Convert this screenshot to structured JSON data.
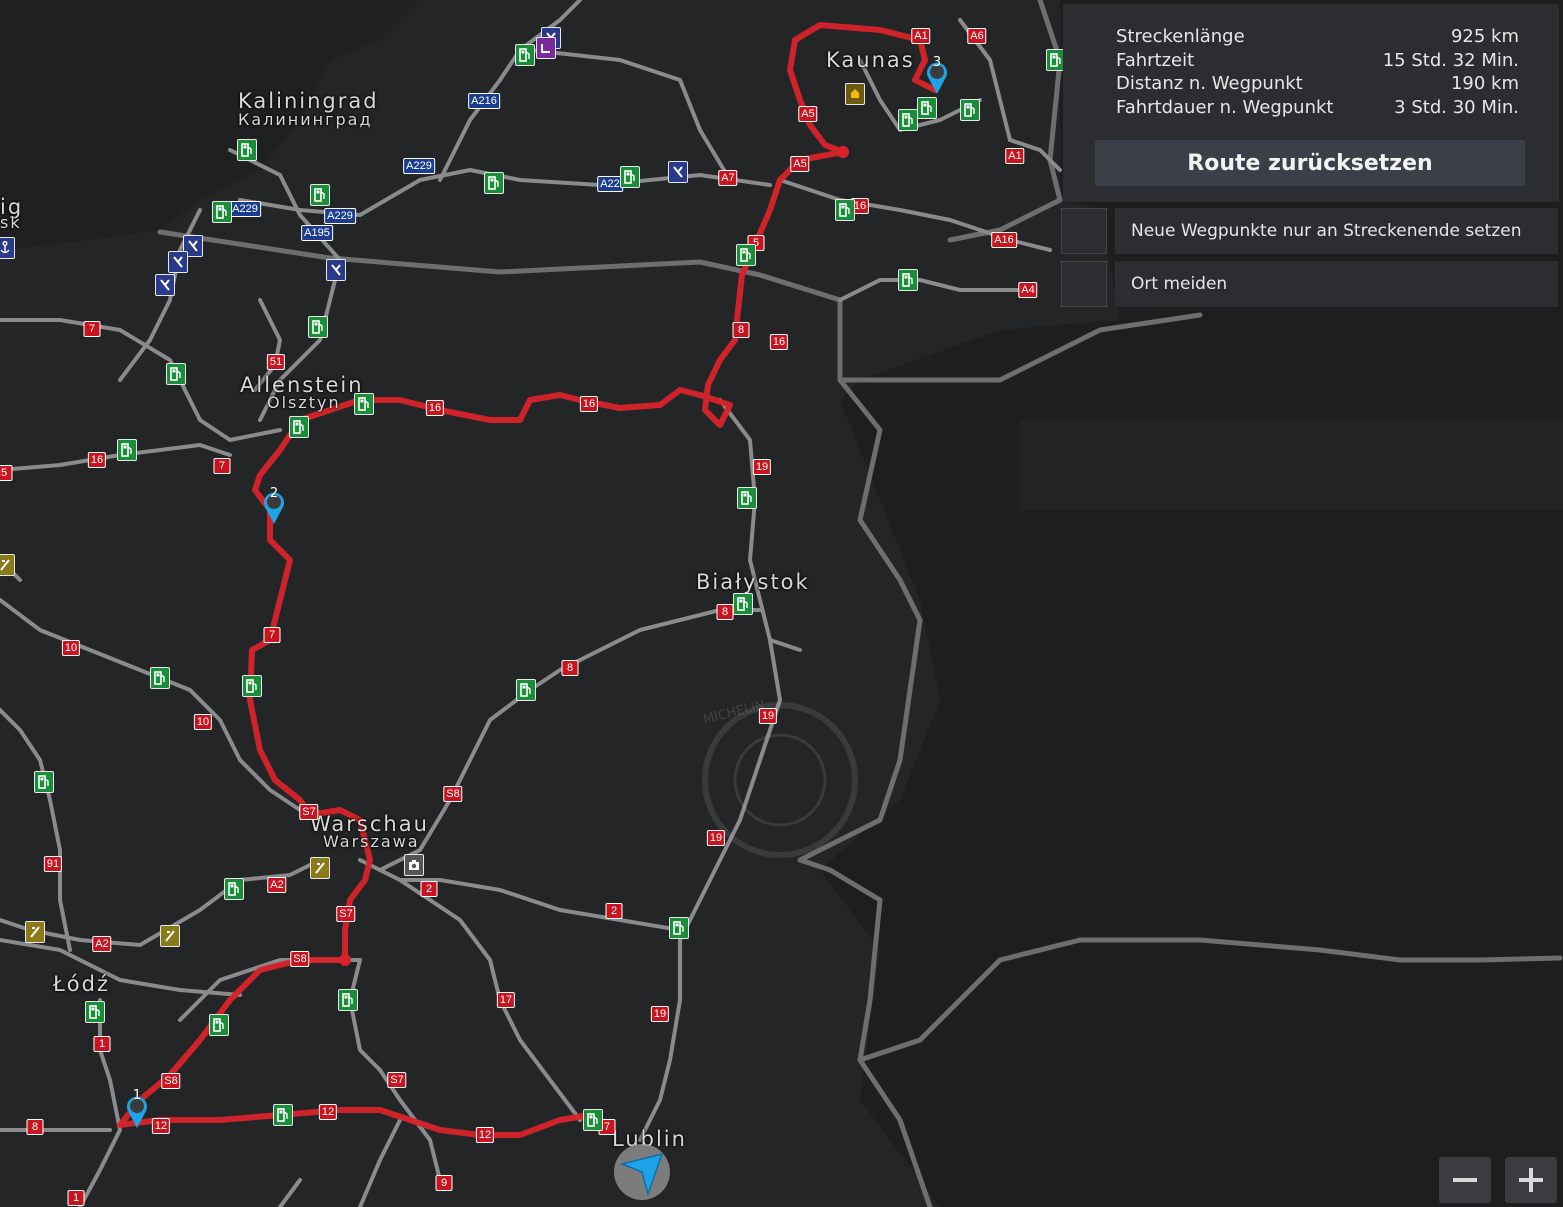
{
  "colors": {
    "background": "#1e1e1f",
    "land_dark": "#242526",
    "road": "#8a8a8a",
    "route": "#d8232a",
    "panel": "#2c2d30",
    "button": "#3a3f48",
    "marker": "#1fa2e6"
  },
  "route_info": {
    "rows": [
      {
        "label": "Streckenlänge",
        "value": "925 km"
      },
      {
        "label": "Fahrtzeit",
        "value": "15 Std. 32 Min."
      },
      {
        "label": "Distanz n. Wegpunkt",
        "value": "190 km"
      },
      {
        "label": "Fahrtdauer n. Wegpunkt",
        "value": "3 Std. 30 Min."
      }
    ],
    "reset_label": "Route zurücksetzen"
  },
  "options": [
    {
      "label": "Neue Wegpunkte nur an Streckenende setzen",
      "checked": false
    },
    {
      "label": "Ort meiden",
      "checked": false
    }
  ],
  "zoom": {
    "out_icon": "minus-icon",
    "in_icon": "plus-icon"
  },
  "cities": {
    "kaliningrad": {
      "name": "Kaliningrad",
      "local": "Калининград"
    },
    "kaunas": {
      "name": "Kaunas"
    },
    "allenstein": {
      "name": "Allenstein",
      "local": "Olsztyn"
    },
    "bialystok": {
      "name": "Białystok"
    },
    "warschau": {
      "name": "Warschau",
      "local": "Warszawa"
    },
    "lodz": {
      "name": "Łódź"
    },
    "lublin": {
      "name": "Lublin"
    },
    "edge_left": {
      "name": "ig",
      "local": "sk"
    }
  },
  "waypoints": [
    {
      "number": "1"
    },
    {
      "number": "2"
    },
    {
      "number": "3"
    }
  ],
  "road_badges": [
    {
      "text": "A1",
      "kind": "red"
    },
    {
      "text": "A6",
      "kind": "red"
    },
    {
      "text": "A5",
      "kind": "red"
    },
    {
      "text": "A5",
      "kind": "red"
    },
    {
      "text": "A7",
      "kind": "red"
    },
    {
      "text": "A1",
      "kind": "red"
    },
    {
      "text": "16",
      "kind": "red"
    },
    {
      "text": "A16",
      "kind": "red"
    },
    {
      "text": "A4",
      "kind": "red"
    },
    {
      "text": "5",
      "kind": "red"
    },
    {
      "text": "8",
      "kind": "red"
    },
    {
      "text": "16",
      "kind": "red"
    },
    {
      "text": "16",
      "kind": "red"
    },
    {
      "text": "16",
      "kind": "red"
    },
    {
      "text": "19",
      "kind": "red"
    },
    {
      "text": "8",
      "kind": "red"
    },
    {
      "text": "8",
      "kind": "red"
    },
    {
      "text": "19",
      "kind": "red"
    },
    {
      "text": "19",
      "kind": "red"
    },
    {
      "text": "19",
      "kind": "red"
    },
    {
      "text": "7",
      "kind": "red"
    },
    {
      "text": "51",
      "kind": "red"
    },
    {
      "text": "7",
      "kind": "red"
    },
    {
      "text": "16",
      "kind": "red"
    },
    {
      "text": "5",
      "kind": "red"
    },
    {
      "text": "7",
      "kind": "red"
    },
    {
      "text": "10",
      "kind": "red"
    },
    {
      "text": "10",
      "kind": "red"
    },
    {
      "text": "S7",
      "kind": "red"
    },
    {
      "text": "S8",
      "kind": "red"
    },
    {
      "text": "91",
      "kind": "red"
    },
    {
      "text": "A2",
      "kind": "red"
    },
    {
      "text": "A2",
      "kind": "red"
    },
    {
      "text": "2",
      "kind": "red"
    },
    {
      "text": "S7",
      "kind": "red"
    },
    {
      "text": "2",
      "kind": "red"
    },
    {
      "text": "S8",
      "kind": "red"
    },
    {
      "text": "17",
      "kind": "red"
    },
    {
      "text": "1",
      "kind": "red"
    },
    {
      "text": "S8",
      "kind": "red"
    },
    {
      "text": "S7",
      "kind": "red"
    },
    {
      "text": "12",
      "kind": "red"
    },
    {
      "text": "12",
      "kind": "red"
    },
    {
      "text": "12",
      "kind": "red"
    },
    {
      "text": "8",
      "kind": "red"
    },
    {
      "text": "7",
      "kind": "red"
    },
    {
      "text": "9",
      "kind": "red"
    },
    {
      "text": "1",
      "kind": "red"
    },
    {
      "text": "A216",
      "kind": "blue"
    },
    {
      "text": "A229",
      "kind": "blue"
    },
    {
      "text": "A229",
      "kind": "blue"
    },
    {
      "text": "A229",
      "kind": "blue"
    },
    {
      "text": "A195",
      "kind": "blue"
    },
    {
      "text": "A22",
      "kind": "blue"
    }
  ],
  "map_watermark": "MICHELIN"
}
